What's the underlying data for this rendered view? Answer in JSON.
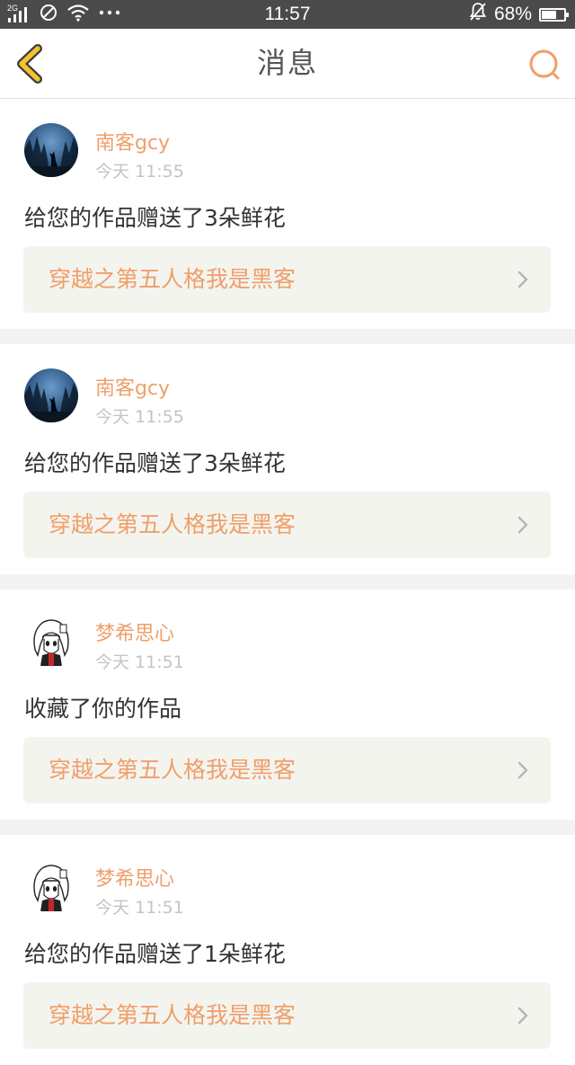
{
  "status_bar": {
    "network": "2G",
    "time": "11:57",
    "battery_text": "68%",
    "battery_level": 0.68
  },
  "header": {
    "title": "消息",
    "back_icon": "chevron-left-icon",
    "search_icon": "search-icon"
  },
  "colors": {
    "accent": "#ef9f6a",
    "back_icon": "#f2c230",
    "status_bar_bg": "#4a4a4a"
  },
  "messages": [
    {
      "user": "南客gcy",
      "avatar": "wolf-night-avatar",
      "time": "今天 11:55",
      "text": "给您的作品赠送了3朵鲜花",
      "work": "穿越之第五人格我是黑客"
    },
    {
      "user": "南客gcy",
      "avatar": "wolf-night-avatar",
      "time": "今天 11:55",
      "text": "给您的作品赠送了3朵鲜花",
      "work": "穿越之第五人格我是黑客"
    },
    {
      "user": "梦希思心",
      "avatar": "anime-girl-avatar",
      "time": "今天 11:51",
      "text": "收藏了你的作品",
      "work": "穿越之第五人格我是黑客"
    },
    {
      "user": "梦希思心",
      "avatar": "anime-girl-avatar",
      "time": "今天 11:51",
      "text": "给您的作品赠送了1朵鲜花",
      "work": "穿越之第五人格我是黑客"
    }
  ]
}
